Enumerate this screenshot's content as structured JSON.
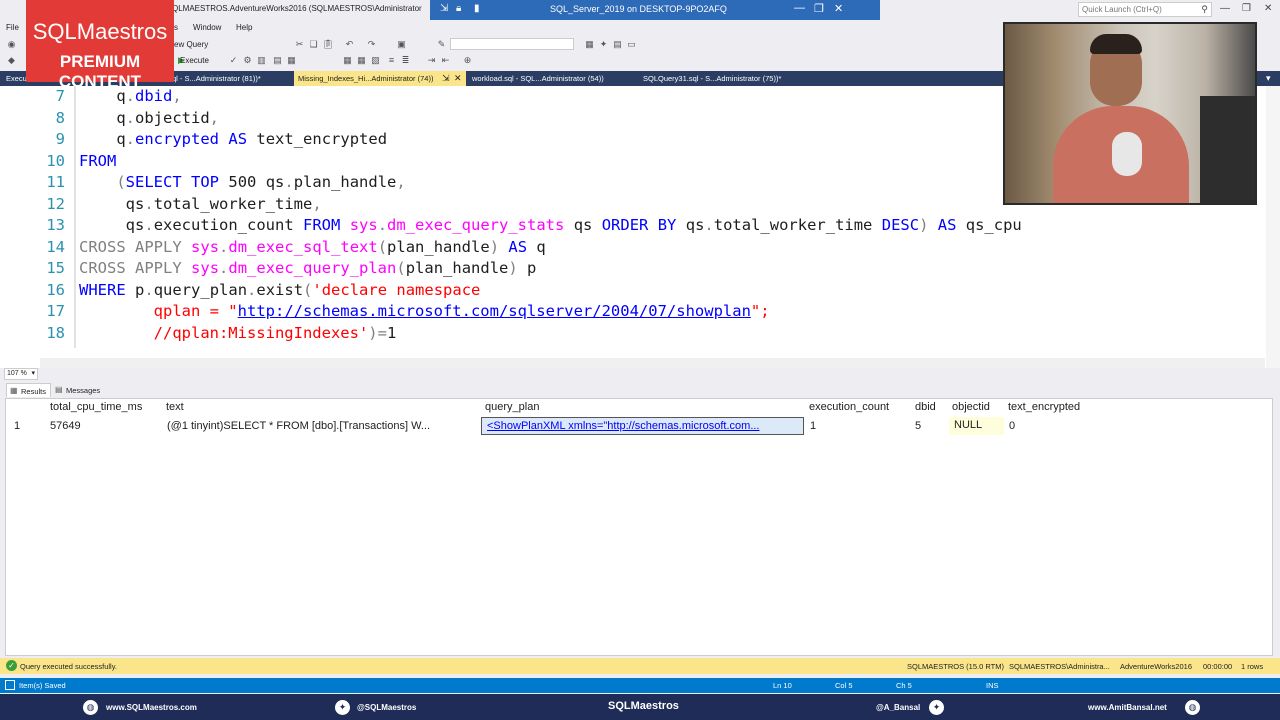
{
  "window": {
    "title_left": "QLMAESTROS.AdventureWorks2016 (SQLMAESTROS\\Administrator",
    "title_center": "SQL_Server_2019 on DESKTOP-9PO2AFQ",
    "quick_launch_placeholder": "Quick Launch (Ctrl+Q)"
  },
  "brand": {
    "logo": "SQLMaestros",
    "subtitle": "PREMIUM CONTENT"
  },
  "menu": {
    "file": "File",
    "views": "s",
    "window": "Window",
    "help": "Help"
  },
  "toolbar": {
    "new_query": "ew Query",
    "execute": "Execute"
  },
  "tabs": [
    {
      "label": "Execu"
    },
    {
      "label": "ql - S...Administrator (81))*"
    },
    {
      "label": "Missing_Indexes_Hi...Administrator (74))"
    },
    {
      "label": "workload.sql - SQL...Administrator (54))"
    },
    {
      "label": "SQLQuery31.sql - S...Administrator (75))*"
    }
  ],
  "editor": {
    "lines": [
      {
        "num": "7"
      },
      {
        "num": "8"
      },
      {
        "num": "9"
      },
      {
        "num": "10"
      },
      {
        "num": "11"
      },
      {
        "num": "12"
      },
      {
        "num": "13"
      },
      {
        "num": "14"
      },
      {
        "num": "15"
      },
      {
        "num": "16"
      },
      {
        "num": "17"
      },
      {
        "num": "18"
      }
    ],
    "tokens": {
      "q": "q",
      "dot": ".",
      "comma": ",",
      "dbid": "dbid",
      "objectid": "objectid",
      "encrypted": "encrypted",
      "as": "AS",
      "text_encrypted": "text_encrypted",
      "from": "FROM",
      "lparen": "(",
      "rparen": ")",
      "select": "SELECT",
      "top": "TOP",
      "n500": "500",
      "qs": "qs",
      "plan_handle": "plan_handle",
      "total_worker_time": "total_worker_time",
      "execution_count": "execution_count",
      "sys": "sys",
      "dm_exec_query_stats": "dm_exec_query_stats",
      "order": "ORDER",
      "by": "BY",
      "desc": "DESC",
      "qs_cpu": "qs_cpu",
      "cross": "CROSS",
      "apply": "APPLY",
      "dm_exec_sql_text": "dm_exec_sql_text",
      "dm_exec_query_plan": "dm_exec_query_plan",
      "p": "p",
      "where": "WHERE",
      "query_plan": "query_plan",
      "exist": "exist",
      "str_declare": "'declare namespace",
      "str_qplan": "qplan = \"",
      "url": "http://schemas.microsoft.com/sqlserver/2004/07/showplan",
      "str_close": "\";",
      "str_missing": "//qplan:MissingIndexes'",
      "eq": "=",
      "one": "1"
    },
    "zoom": "107 %"
  },
  "results_tabs": {
    "results": "Results",
    "messages": "Messages"
  },
  "grid": {
    "columns": [
      "total_cpu_time_ms",
      "text",
      "query_plan",
      "execution_count",
      "dbid",
      "objectid",
      "text_encrypted"
    ],
    "rows": [
      {
        "num": "1",
        "total_cpu_time_ms": "57649",
        "text": "(@1 tinyint)SELECT * FROM [dbo].[Transactions] W...",
        "query_plan": "<ShowPlanXML xmlns=\"http://schemas.microsoft.com...",
        "execution_count": "1",
        "dbid": "5",
        "objectid": "NULL",
        "text_encrypted": "0"
      }
    ]
  },
  "status": {
    "message": "Query executed successfully.",
    "server": "SQLMAESTROS (15.0 RTM)",
    "user": "SQLMAESTROS\\Administra...",
    "database": "AdventureWorks2016",
    "elapsed": "00:00:00",
    "rows": "1 rows"
  },
  "vs_status": {
    "saved": "Item(s) Saved",
    "ln": "Ln 10",
    "col": "Col 5",
    "ch": "Ch 5",
    "ins": "INS"
  },
  "footer": {
    "website": "www.SQLMaestros.com",
    "twitter1": "@SQLMaestros",
    "logo": "SQLMaestros",
    "twitter2": "@A_Bansal",
    "website2": "www.AmitBansal.net"
  },
  "colors": {
    "keyword": "#0000ff",
    "function": "#ff00ff",
    "string": "#ff0000",
    "line_number": "#2b91af",
    "tab_bar": "#2b3d62",
    "active_tab": "#fbe58b",
    "status_bar": "#007acc",
    "brand_red": "#e23b37"
  },
  "icons": {
    "save": "save-icon",
    "undo": "undo-icon",
    "redo": "redo-icon",
    "execute": "play-icon",
    "search": "search-icon",
    "status_ok": "check-icon"
  }
}
